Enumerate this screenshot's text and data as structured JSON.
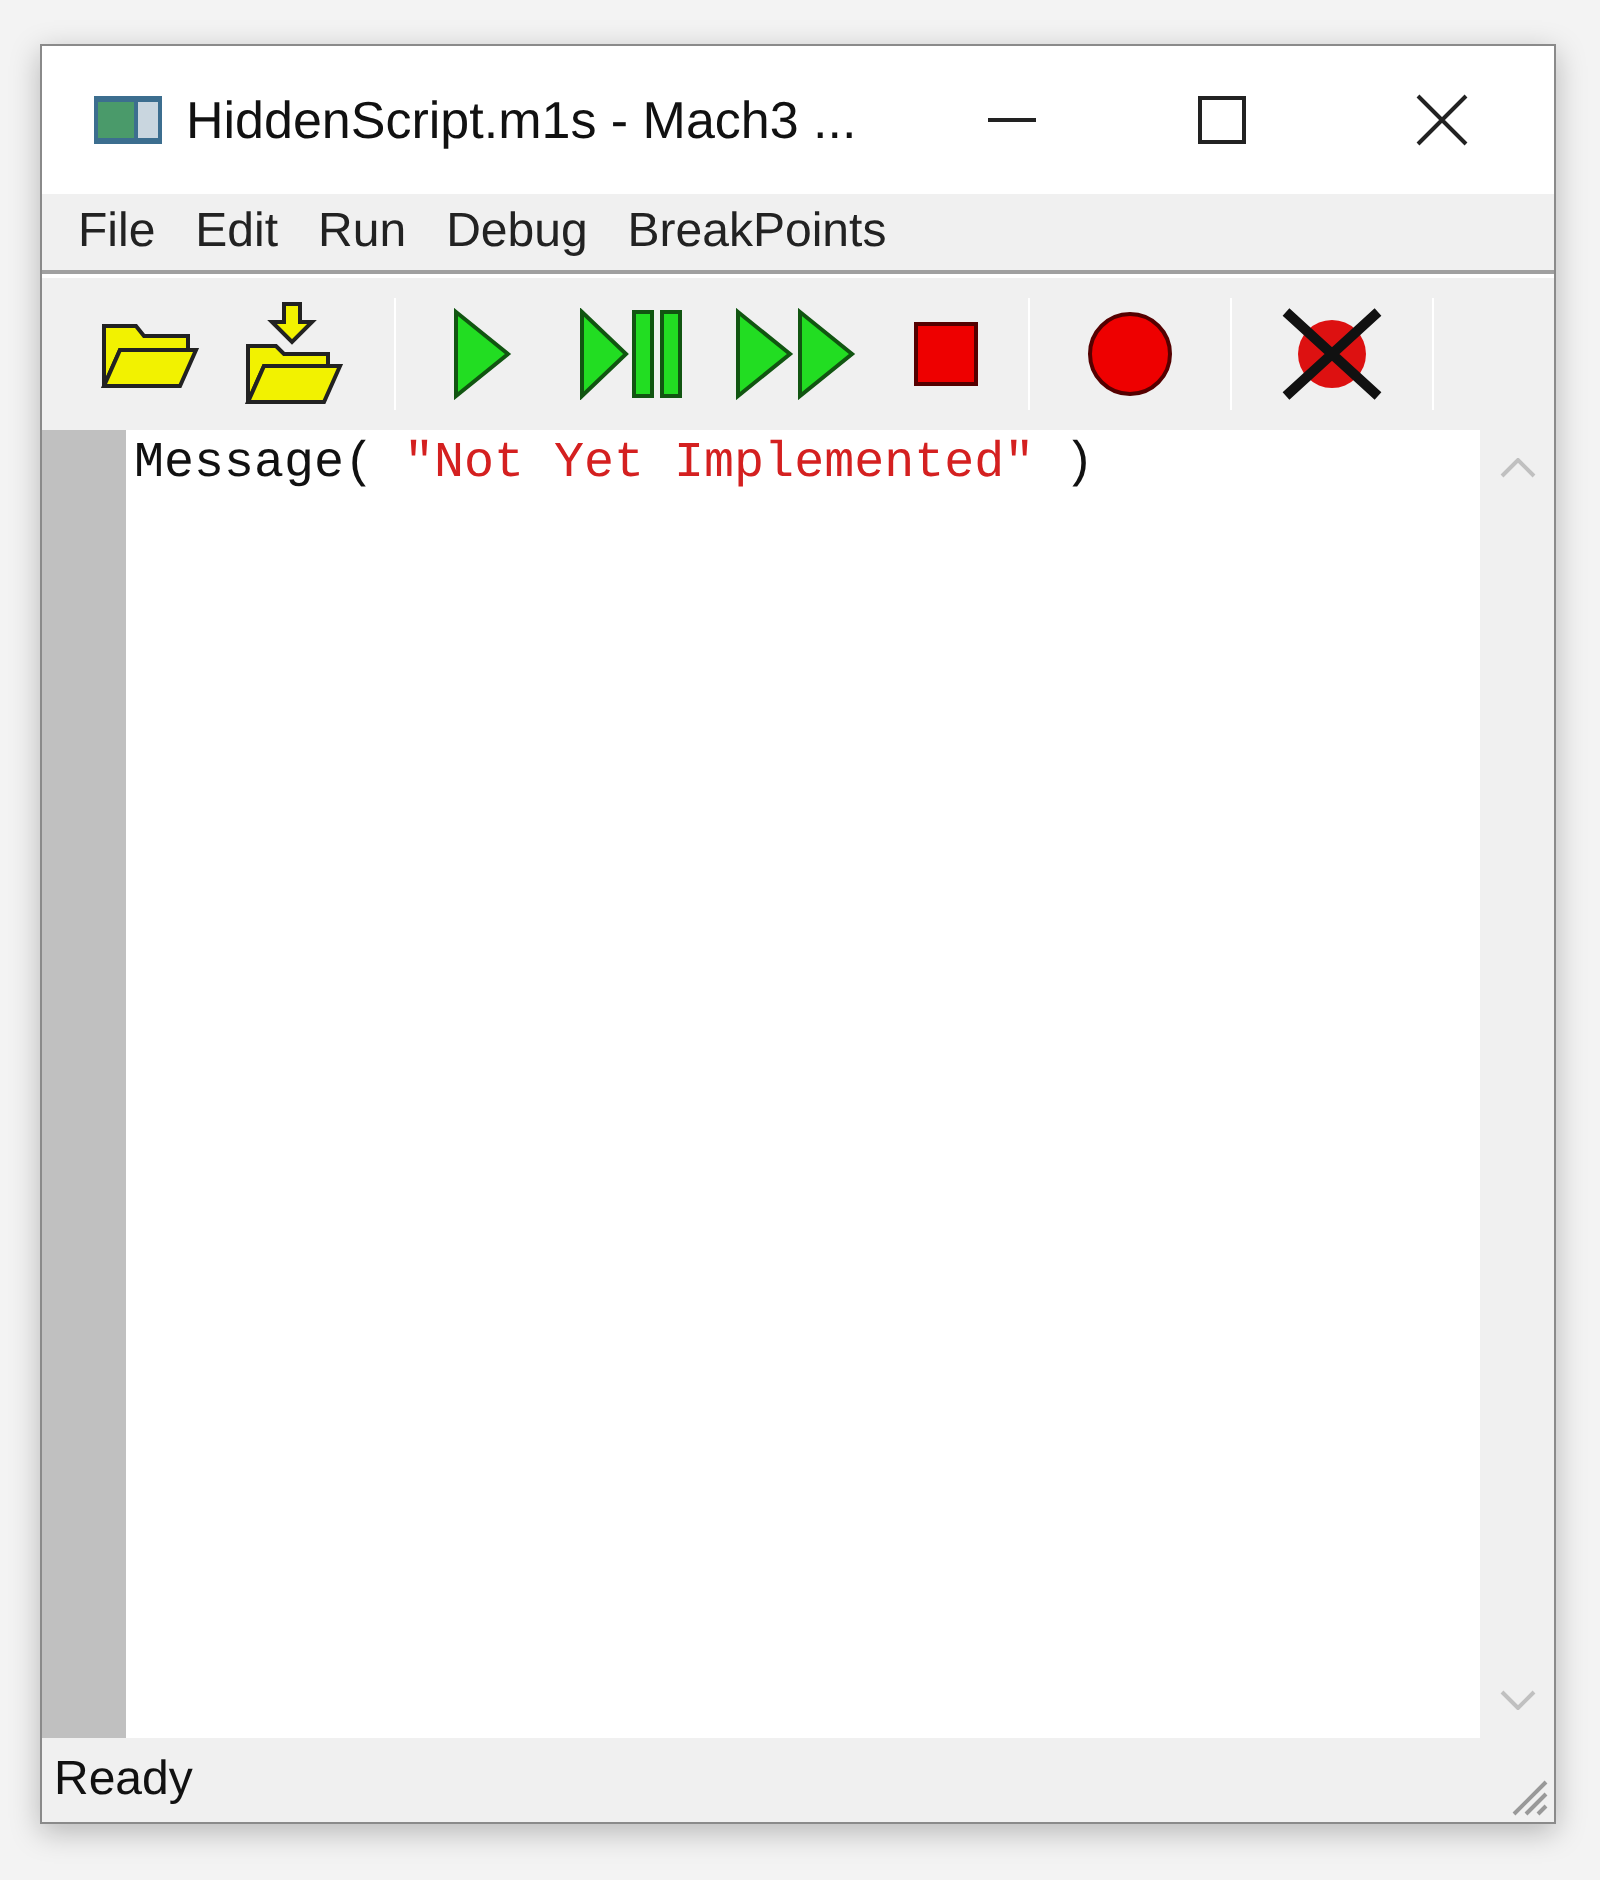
{
  "window": {
    "title": "HiddenScript.m1s - Mach3 ..."
  },
  "menu": [
    "File",
    "Edit",
    "Run",
    "Debug",
    "BreakPoints"
  ],
  "editor": {
    "lines": [
      [
        {
          "kind": "plain",
          "text": "Message( "
        },
        {
          "kind": "string",
          "text": "\"Not Yet Implemented\""
        },
        {
          "kind": "plain",
          "text": " )"
        }
      ]
    ]
  },
  "status_bar": "Ready"
}
